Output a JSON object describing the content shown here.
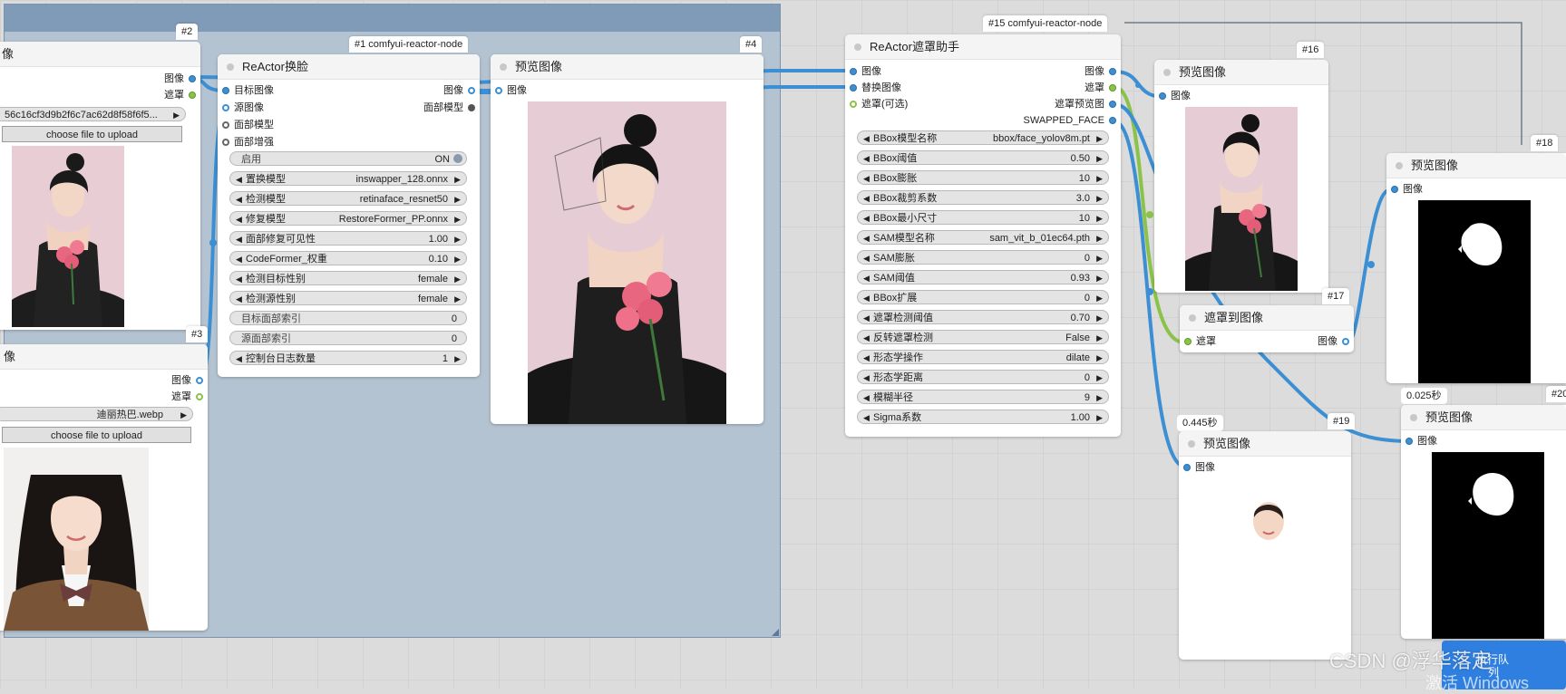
{
  "node_2": {
    "badge": "#2",
    "header_partial": "像",
    "outputs": [
      "图像",
      "遮罩"
    ],
    "file_value": "56c16cf3d9b2f6c7ac62d8f58f6f5...",
    "upload_label": "choose file to upload"
  },
  "node_3": {
    "badge": "#3",
    "header_partial": "像",
    "outputs": [
      "图像",
      "遮罩"
    ],
    "file_value": "迪丽热巴.webp",
    "upload_label": "choose file to upload"
  },
  "node_1": {
    "badge": "#1 comfyui-reactor-node",
    "title": "ReActor换脸",
    "inputs": [
      "目标图像",
      "源图像",
      "面部模型",
      "面部增强"
    ],
    "outputs": [
      "图像",
      "面部模型"
    ],
    "toggle": {
      "label": "启用",
      "value": "ON"
    },
    "widgets": [
      {
        "label": "置换模型",
        "value": "inswapper_128.onnx"
      },
      {
        "label": "检测模型",
        "value": "retinaface_resnet50"
      },
      {
        "label": "修复模型",
        "value": "RestoreFormer_PP.onnx"
      },
      {
        "label": "面部修复可见性",
        "value": "1.00"
      },
      {
        "label": "CodeFormer_权重",
        "value": "0.10"
      },
      {
        "label": "检测目标性别",
        "value": "female"
      },
      {
        "label": "检测源性别",
        "value": "female"
      }
    ],
    "plain_widgets": [
      {
        "label": "目标面部索引",
        "value": "0"
      },
      {
        "label": "源面部索引",
        "value": "0"
      }
    ],
    "last_widget": {
      "label": "控制台日志数量",
      "value": "1"
    }
  },
  "node_4": {
    "badge": "#4",
    "title": "预览图像",
    "inputs": [
      "图像"
    ]
  },
  "node_15": {
    "badge": "#15 comfyui-reactor-node",
    "title": "ReActor遮罩助手",
    "inputs": [
      "图像",
      "替换图像",
      "遮罩(可选)"
    ],
    "outputs": [
      "图像",
      "遮罩",
      "遮罩预览图",
      "SWAPPED_FACE"
    ],
    "widgets": [
      {
        "label": "BBox模型名称",
        "value": "bbox/face_yolov8m.pt"
      },
      {
        "label": "BBox阈值",
        "value": "0.50"
      },
      {
        "label": "BBox膨胀",
        "value": "10"
      },
      {
        "label": "BBox裁剪系数",
        "value": "3.0"
      },
      {
        "label": "BBox最小尺寸",
        "value": "10"
      },
      {
        "label": "SAM模型名称",
        "value": "sam_vit_b_01ec64.pth"
      },
      {
        "label": "SAM膨胀",
        "value": "0"
      },
      {
        "label": "SAM阈值",
        "value": "0.93"
      },
      {
        "label": "BBox扩展",
        "value": "0"
      },
      {
        "label": "遮罩检测阈值",
        "value": "0.70"
      },
      {
        "label": "反转遮罩检测",
        "value": "False"
      },
      {
        "label": "形态学操作",
        "value": "dilate"
      },
      {
        "label": "形态学距离",
        "value": "0"
      },
      {
        "label": "模糊半径",
        "value": "9"
      },
      {
        "label": "Sigma系数",
        "value": "1.00"
      }
    ]
  },
  "node_16": {
    "badge": "#16",
    "title": "预览图像",
    "inputs": [
      "图像"
    ]
  },
  "node_17": {
    "badge": "#17",
    "title": "遮罩到图像",
    "inputs": [
      "遮罩"
    ],
    "outputs": [
      "图像"
    ]
  },
  "node_18": {
    "badge": "#18",
    "title": "预览图像",
    "inputs": [
      "图像"
    ]
  },
  "node_19": {
    "badge": "#19",
    "time": "0.445秒",
    "title": "预览图像",
    "inputs": [
      "图像"
    ]
  },
  "node_20": {
    "badge": "#20",
    "time": "0.025秒",
    "title": "预览图像",
    "inputs": [
      "图像"
    ]
  },
  "overlay": {
    "watermark": "CSDN @浮华落定",
    "windows_text": "激活 Windows",
    "tab_text_1": "执行队",
    "tab_text_2": "列"
  },
  "colors": {
    "canvas_bg": "#dcdcdc",
    "group_bg": "#b4c3d1",
    "group_title": "#7f9bb7",
    "image_wire": "#3c8fd3",
    "mask_wire": "#8bc34a"
  }
}
